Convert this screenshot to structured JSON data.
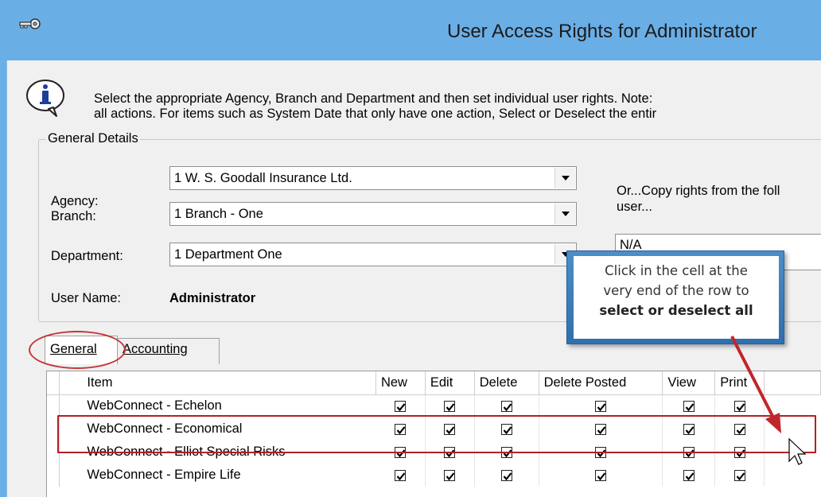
{
  "window": {
    "title": "User Access Rights for Administrator"
  },
  "info": {
    "line1": "Select the appropriate Agency, Branch and Department and then set individual user rights.  Note:",
    "line2": "all actions.  For items such as System Date that only have one action, Select or Deselect the entir"
  },
  "general_details": {
    "legend": "General Details",
    "agency_label": "Agency:",
    "agency_value": "1 W. S. Goodall Insurance Ltd.",
    "branch_label": "Branch:",
    "branch_value": "1 Branch - One",
    "department_label": "Department:",
    "department_value": "1 Department One",
    "username_label": "User Name:",
    "username_value": "Administrator",
    "copy_line1": "Or...Copy rights from the foll",
    "copy_line2": "user...",
    "copy_value": "N/A"
  },
  "tabs": {
    "general": "General",
    "accounting": "Accounting"
  },
  "grid": {
    "columns": [
      "Item",
      "New",
      "Edit",
      "Delete",
      "Delete Posted",
      "View",
      "Print"
    ],
    "rows": [
      {
        "item": "WebConnect - Echelon"
      },
      {
        "item": "WebConnect - Economical"
      },
      {
        "item": "WebConnect - Elliot Special Risks"
      },
      {
        "item": "WebConnect - Empire Life"
      }
    ]
  },
  "callout": {
    "line1": "Click in the cell at the",
    "line2": "very end of the row to",
    "line3": "select or deselect all"
  },
  "colors": {
    "titlebar": "#6aaee6",
    "highlight": "#b32025",
    "callout_border": "#2f6fae"
  }
}
